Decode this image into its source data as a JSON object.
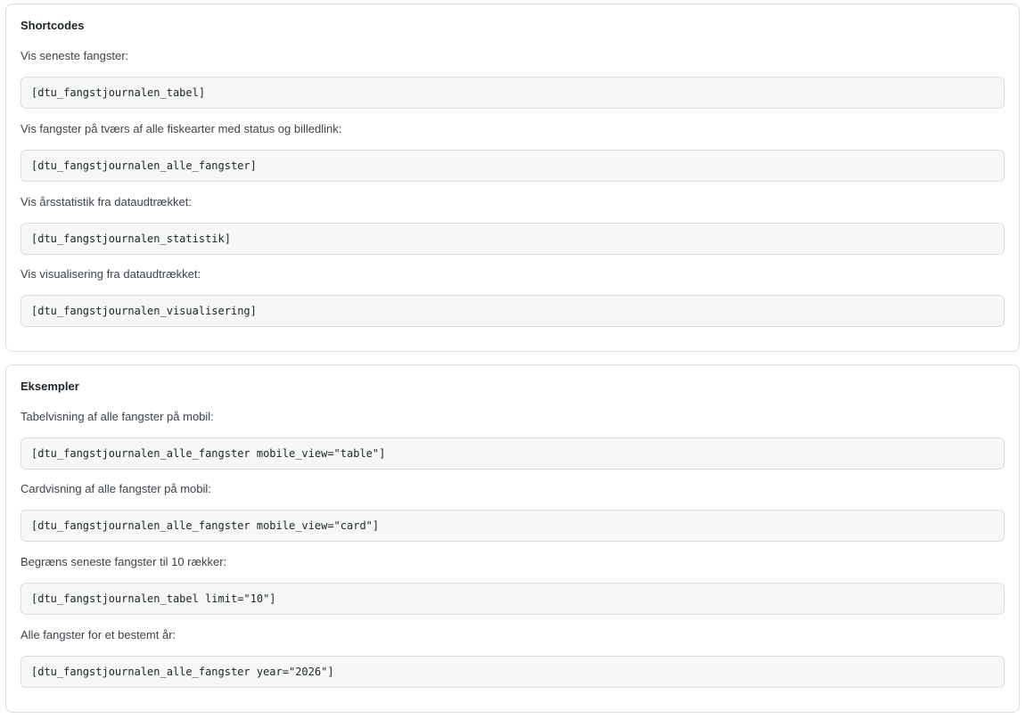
{
  "shortcodes": {
    "title": "Shortcodes",
    "items": [
      {
        "label": "Vis seneste fangster:",
        "code": "[dtu_fangstjournalen_tabel]"
      },
      {
        "label": "Vis fangster på tværs af alle fiskearter med status og billedlink:",
        "code": "[dtu_fangstjournalen_alle_fangster]"
      },
      {
        "label": "Vis årsstatistik fra dataudtrækket:",
        "code": "[dtu_fangstjournalen_statistik]"
      },
      {
        "label": "Vis visualisering fra dataudtrækket:",
        "code": "[dtu_fangstjournalen_visualisering]"
      }
    ]
  },
  "examples": {
    "title": "Eksempler",
    "items": [
      {
        "label": "Tabelvisning af alle fangster på mobil:",
        "code": "[dtu_fangstjournalen_alle_fangster mobile_view=\"table\"]"
      },
      {
        "label": "Cardvisning af alle fangster på mobil:",
        "code": "[dtu_fangstjournalen_alle_fangster mobile_view=\"card\"]"
      },
      {
        "label": "Begræns seneste fangster til 10 rækker:",
        "code": "[dtu_fangstjournalen_tabel limit=\"10\"]"
      },
      {
        "label": "Alle fangster for et bestemt år:",
        "code": "[dtu_fangstjournalen_alle_fangster year=\"2026\"]"
      }
    ]
  }
}
